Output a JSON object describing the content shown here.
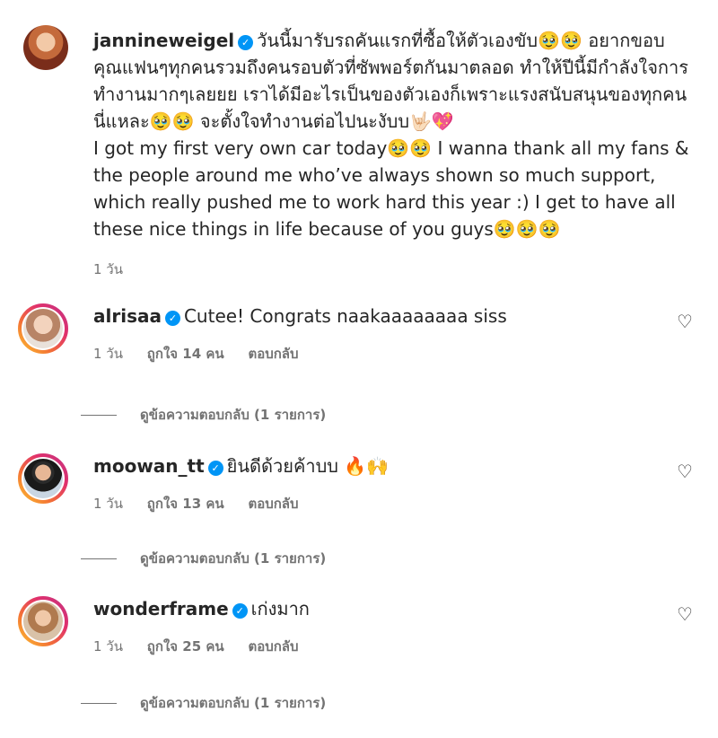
{
  "caption": {
    "username": "jannineweigel",
    "text_th": "วันนี้มารับรถคันแรกที่ซื้อให้ตัวเองขับ🥹🥹 อยากขอบคุณแฟนๆทุกคนรวมถึงคนรอบตัวที่ซัพพอร์ตกันมาตลอด ทำให้ปีนี้มีกำลังใจการทำงานมากๆเลยยย เราได้มีอะไรเป็นของตัวเองก็เพราะแรงสนับสนุนของทุกคนนี่แหละ🥹🥹 จะตั้งใจทำงานต่อไปนะงับบ🤟🏻💖",
    "text_en": "I got my first very own car today🥹🥹 I wanna thank all my fans & the people around me who’ve always shown so much support, which really pushed me to work hard this year :) I get to have all these nice things in life because of you guys🥹🥹🥹",
    "time": "1 วัน"
  },
  "comments": [
    {
      "username": "alrisaa",
      "text": "Cutee! Congrats naakaaaaaaaa siss",
      "time": "1 วัน",
      "likes": "ถูกใจ 14 คน",
      "reply": "ตอบกลับ",
      "view_replies": "ดูข้อความตอบกลับ (1 รายการ)"
    },
    {
      "username": "moowan_tt",
      "text": "ยินดีด้วยค้าบบ 🔥🙌",
      "time": "1 วัน",
      "likes": "ถูกใจ 13 คน",
      "reply": "ตอบกลับ",
      "view_replies": "ดูข้อความตอบกลับ (1 รายการ)"
    },
    {
      "username": "wonderframe",
      "text": "เก่งมาก",
      "time": "1 วัน",
      "likes": "ถูกใจ 25 คน",
      "reply": "ตอบกลับ",
      "view_replies": "ดูข้อความตอบกลับ (1 รายการ)"
    }
  ],
  "icons": {
    "verified": "verified-badge-icon",
    "heart": "heart-outline-icon"
  },
  "colors": {
    "verified": "#0095f6",
    "meta": "#737373",
    "story_ring_start": "#fdc830",
    "story_ring_end": "#c13584"
  }
}
